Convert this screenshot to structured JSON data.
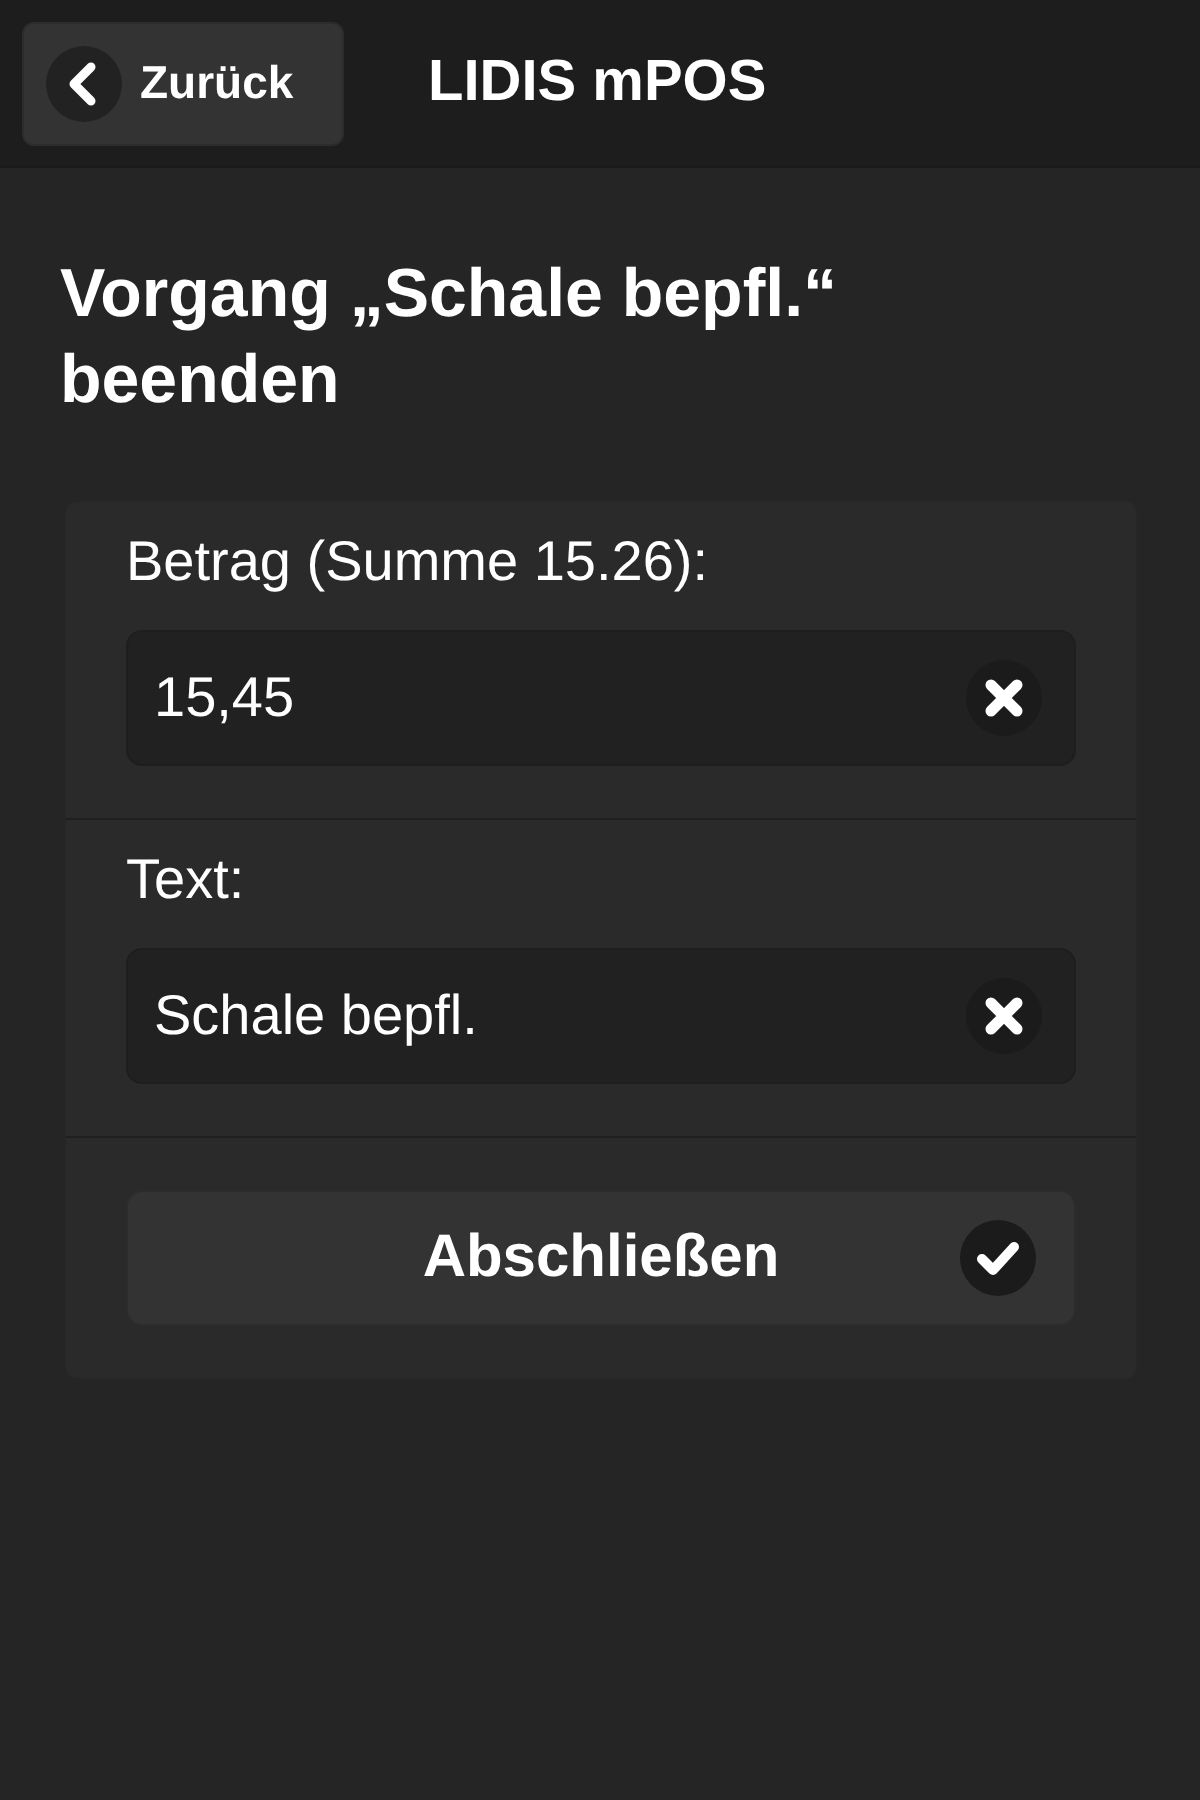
{
  "header": {
    "back_button": {
      "label": "Zurück"
    },
    "title": "LIDIS mPOS"
  },
  "heading": "Vorgang „Schale bepfl.“ beenden",
  "fields": [
    {
      "label": "Betrag (Summe 15.26):",
      "value": "15,45"
    },
    {
      "label": "Text:",
      "value": "Schale bepfl."
    }
  ],
  "submit_button": {
    "label": "Abschließen"
  }
}
